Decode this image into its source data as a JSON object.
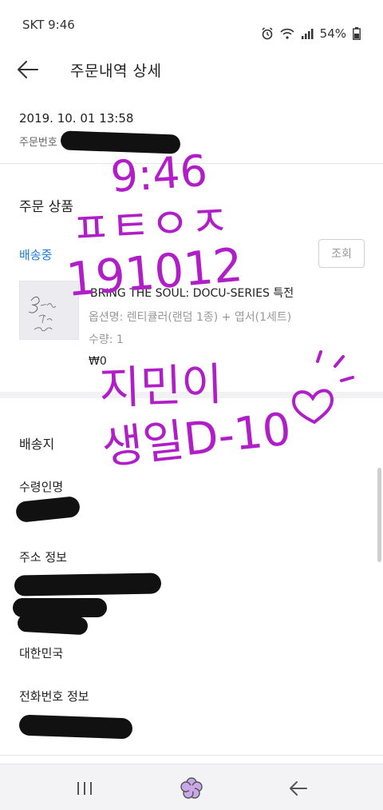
{
  "status_bar": {
    "carrier_time": "SKT 9:46",
    "battery": "54%"
  },
  "header": {
    "title": "주문내역 상세",
    "back_icon": "arrow-left-icon"
  },
  "order": {
    "date": "2019. 10. 01 13:58",
    "number_label": "주문번호 1"
  },
  "products_section": {
    "title": "주문 상품",
    "status": "배송중",
    "lookup_button": "조회",
    "item": {
      "name": "BRING THE SOUL: DOCU-SERIES 특전",
      "option": "옵션명: 렌티큘러(랜덤 1종) + 엽서(1세트)",
      "quantity": "수량: 1",
      "price": "₩0",
      "thumb_text": "Bring the Soul"
    }
  },
  "shipping_section": {
    "title": "배송지",
    "recipient_label": "수령인명",
    "address_label": "주소 정보",
    "country": "대한민국",
    "phone_label": "전화번호 정보"
  },
  "handwriting": {
    "line1": "9:46",
    "line2": "ㅍㅌㅇㅈ",
    "line3": "191012",
    "line4": "지민이",
    "line5": "생일D-10",
    "color": "#b01ec8"
  },
  "nav_bar": {
    "recents_icon": "recent-apps-icon",
    "home_icon": "flower-home-icon",
    "back_icon": "back-arrow-icon"
  }
}
